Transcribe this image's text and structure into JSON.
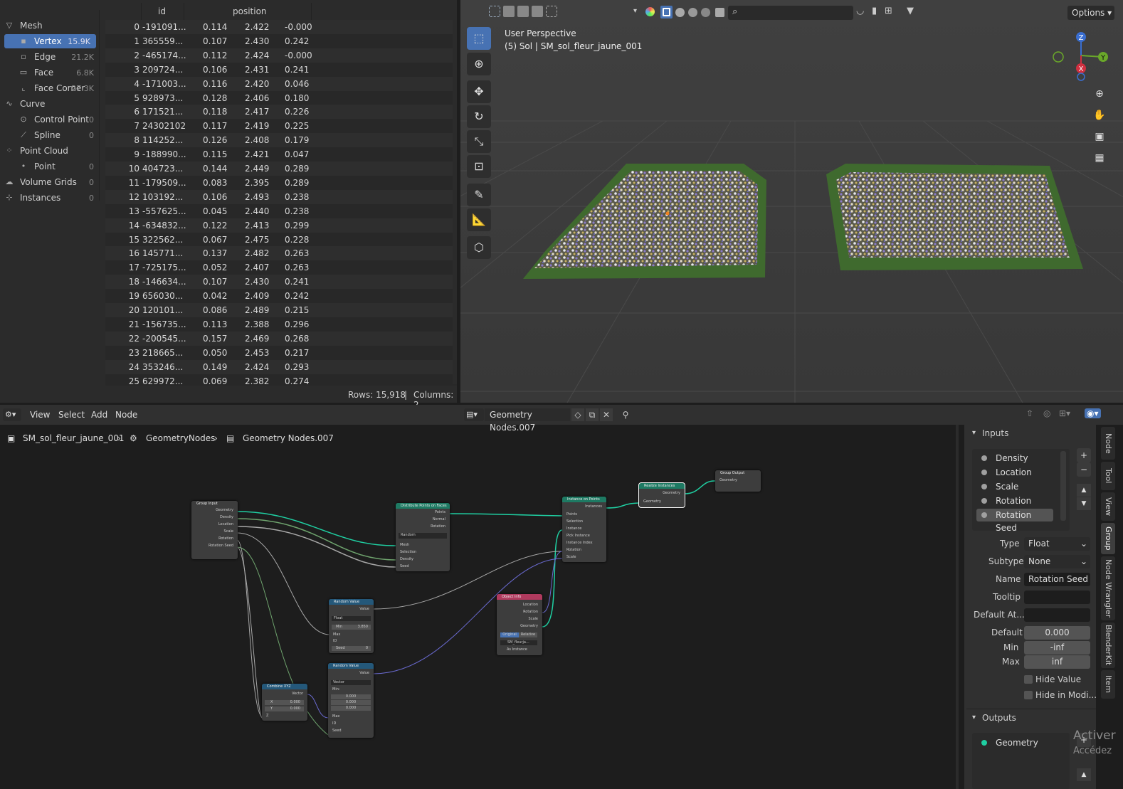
{
  "spreadsheet": {
    "tree": [
      {
        "label": "Mesh",
        "count": "",
        "icon": "mesh-icon"
      },
      {
        "label": "Vertex",
        "count": "15.9K",
        "icon": "vertex-icon"
      },
      {
        "label": "Edge",
        "count": "21.2K",
        "icon": "edge-icon"
      },
      {
        "label": "Face",
        "count": "6.8K",
        "icon": "face-icon"
      },
      {
        "label": "Face Corner",
        "count": "27.3K",
        "icon": "face-corner-icon"
      },
      {
        "label": "Curve",
        "count": "",
        "icon": "curve-icon"
      },
      {
        "label": "Control Point",
        "count": "0",
        "icon": "control-point-icon"
      },
      {
        "label": "Spline",
        "count": "0",
        "icon": "spline-icon"
      },
      {
        "label": "Point Cloud",
        "count": "",
        "icon": "point-cloud-icon"
      },
      {
        "label": "Point",
        "count": "0",
        "icon": "point-icon"
      },
      {
        "label": "Volume Grids",
        "count": "0",
        "icon": "volume-icon"
      },
      {
        "label": "Instances",
        "count": "0",
        "icon": "instances-icon"
      }
    ],
    "columns": {
      "id": "id",
      "position": "position"
    },
    "rows": [
      [
        "0",
        "-191091...",
        "0.114",
        "2.422",
        "-0.000"
      ],
      [
        "1",
        "365559...",
        "0.107",
        "2.430",
        "0.242"
      ],
      [
        "2",
        "-465174...",
        "0.112",
        "2.424",
        "-0.000"
      ],
      [
        "3",
        "209724...",
        "0.106",
        "2.431",
        "0.241"
      ],
      [
        "4",
        "-171003...",
        "0.116",
        "2.420",
        "0.046"
      ],
      [
        "5",
        "928973...",
        "0.128",
        "2.406",
        "0.180"
      ],
      [
        "6",
        "171521...",
        "0.118",
        "2.417",
        "0.226"
      ],
      [
        "7",
        "24302102",
        "0.117",
        "2.419",
        "0.225"
      ],
      [
        "8",
        "114252...",
        "0.126",
        "2.408",
        "0.179"
      ],
      [
        "9",
        "-188990...",
        "0.115",
        "2.421",
        "0.047"
      ],
      [
        "10",
        "404723...",
        "0.144",
        "2.449",
        "0.289"
      ],
      [
        "11",
        "-179509...",
        "0.083",
        "2.395",
        "0.289"
      ],
      [
        "12",
        "103192...",
        "0.106",
        "2.493",
        "0.238"
      ],
      [
        "13",
        "-557625...",
        "0.045",
        "2.440",
        "0.238"
      ],
      [
        "14",
        "-634832...",
        "0.122",
        "2.413",
        "0.299"
      ],
      [
        "15",
        "322562...",
        "0.067",
        "2.475",
        "0.228"
      ],
      [
        "16",
        "145771...",
        "0.137",
        "2.482",
        "0.263"
      ],
      [
        "17",
        "-725175...",
        "0.052",
        "2.407",
        "0.263"
      ],
      [
        "18",
        "-146634...",
        "0.107",
        "2.430",
        "0.241"
      ],
      [
        "19",
        "656030...",
        "0.042",
        "2.409",
        "0.242"
      ],
      [
        "20",
        "120101...",
        "0.086",
        "2.489",
        "0.215"
      ],
      [
        "21",
        "-156735...",
        "0.113",
        "2.388",
        "0.296"
      ],
      [
        "22",
        "-200545...",
        "0.157",
        "2.469",
        "0.268"
      ],
      [
        "23",
        "218665...",
        "0.050",
        "2.453",
        "0.217"
      ],
      [
        "24",
        "353246...",
        "0.149",
        "2.424",
        "0.293"
      ],
      [
        "25",
        "629972...",
        "0.069",
        "2.382",
        "0.274"
      ]
    ],
    "footer": {
      "rows": "Rows: 15,918",
      "sep": "|",
      "columns": "Columns: 2"
    }
  },
  "viewport": {
    "title": "User Perspective",
    "subtitle": "(5) Sol | SM_sol_fleur_jaune_001",
    "options": "Options",
    "gizmo": {
      "z": "Z",
      "y": "Y",
      "x": "X"
    }
  },
  "node_editor": {
    "menus": [
      "View",
      "Select",
      "Add",
      "Node"
    ],
    "nodegroup": "Geometry Nodes.007",
    "breadcrumb": [
      "SM_sol_fleur_jaune_001",
      "GeometryNodes",
      "Geometry Nodes.007"
    ],
    "nodes": {
      "group_input": {
        "title": "Group Input",
        "outputs": [
          "Geometry",
          "Density",
          "Location",
          "Scale",
          "Rotation",
          "Rotation Seed"
        ]
      },
      "distribute": {
        "title": "Distribute Points on Faces",
        "outputs": [
          "Points",
          "Normal",
          "Rotation"
        ],
        "mode": "Random",
        "inputs": [
          "Mesh",
          "Selection",
          "Density",
          "Seed"
        ]
      },
      "instance": {
        "title": "Instance on Points",
        "output": "Instances",
        "inputs": [
          "Points",
          "Selection",
          "Instance",
          "Pick Instance",
          "Instance Index",
          "Rotation",
          "Scale"
        ]
      },
      "realize": {
        "title": "Realize Instances",
        "output": "Geometry",
        "input": "Geometry"
      },
      "group_output": {
        "title": "Group Output",
        "input": "Geometry"
      },
      "random1": {
        "title": "Random Value",
        "output": "Value",
        "type": "Float",
        "min_label": "Min",
        "min_value": "3.850",
        "inputs": [
          "Max",
          "ID"
        ],
        "seed_label": "Seed",
        "seed_value": "0"
      },
      "random2": {
        "title": "Random Value",
        "output": "Value",
        "type": "Vector",
        "min_label": "Min:",
        "vals": [
          "0.000",
          "0.000",
          "0.000"
        ],
        "inputs": [
          "Max",
          "ID",
          "Seed"
        ]
      },
      "combine": {
        "title": "Combine XYZ",
        "output": "Vector",
        "x_label": "X",
        "x_value": "0.000",
        "y_label": "Y",
        "y_value": "0.000",
        "z_label": "Z"
      },
      "objinfo": {
        "title": "Object Info",
        "outputs": [
          "Location",
          "Rotation",
          "Scale",
          "Geometry"
        ],
        "btn_original": "Original",
        "btn_relative": "Relative",
        "object": "SM_fleurja...",
        "as_instance": "As Instance"
      }
    }
  },
  "panel": {
    "inputs_title": "Inputs",
    "items": [
      "Density",
      "Location",
      "Scale",
      "Rotation",
      "Rotation Seed"
    ],
    "type_label": "Type",
    "type_value": "Float",
    "subtype_label": "Subtype",
    "subtype_value": "None",
    "name_label": "Name",
    "name_value": "Rotation Seed",
    "tooltip_label": "Tooltip",
    "tooltip_value": "",
    "default_attr_label": "Default At...",
    "default_attr_value": "",
    "default_label": "Default",
    "default_value": "0.000",
    "min_label": "Min",
    "min_value": "-inf",
    "max_label": "Max",
    "max_value": "inf",
    "hide_value": "Hide Value",
    "hide_in_modifier": "Hide in Modi...",
    "outputs_title": "Outputs",
    "output_items": [
      "Geometry"
    ],
    "tabs": [
      "Node",
      "Tool",
      "View",
      "Group",
      "Node Wrangler",
      "BlenderKit",
      "Item"
    ],
    "watermark1": "Activer",
    "watermark2": "Accédez"
  }
}
